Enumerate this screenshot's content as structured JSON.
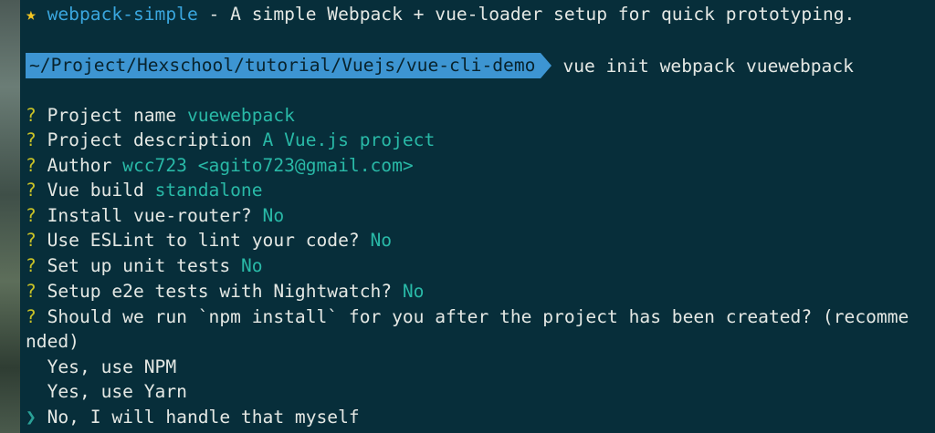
{
  "header": {
    "star_icon": "star-icon",
    "star_glyph": "★",
    "template_name": "webpack-simple",
    "template_desc": " - A simple Webpack + vue-loader setup for quick prototyping."
  },
  "prompt": {
    "path": "~/Project/Hexschool/tutorial/Vuejs/vue-cli-demo",
    "command": "vue init webpack vuewebpack"
  },
  "questions": [
    {
      "mark": "?",
      "label": "Project name",
      "answer": "vuewebpack"
    },
    {
      "mark": "?",
      "label": "Project description",
      "answer": "A Vue.js project"
    },
    {
      "mark": "?",
      "label": "Author",
      "answer": "wcc723 <agito723@gmail.com>"
    },
    {
      "mark": "?",
      "label": "Vue build",
      "answer": "standalone"
    },
    {
      "mark": "?",
      "label": "Install vue-router?",
      "answer": "No"
    },
    {
      "mark": "?",
      "label": "Use ESLint to lint your code?",
      "answer": "No"
    },
    {
      "mark": "?",
      "label": "Set up unit tests",
      "answer": "No"
    },
    {
      "mark": "?",
      "label": "Setup e2e tests with Nightwatch?",
      "answer": "No"
    }
  ],
  "install_question": {
    "mark": "?",
    "line1": "Should we run `npm install` for you after the project has been created? (recomme",
    "line2": "nded)"
  },
  "install_options": {
    "pointer": "❯",
    "items": [
      "Yes, use NPM",
      "Yes, use Yarn",
      "No, I will handle that myself"
    ],
    "selected_index": 2
  },
  "colors": {
    "background": "#072e3a",
    "question_mark": "#c9c227",
    "answer": "#29b9a7",
    "repo_link": "#3aa6de",
    "prompt_bar": "#3d95d2",
    "star": "#f3c623"
  }
}
